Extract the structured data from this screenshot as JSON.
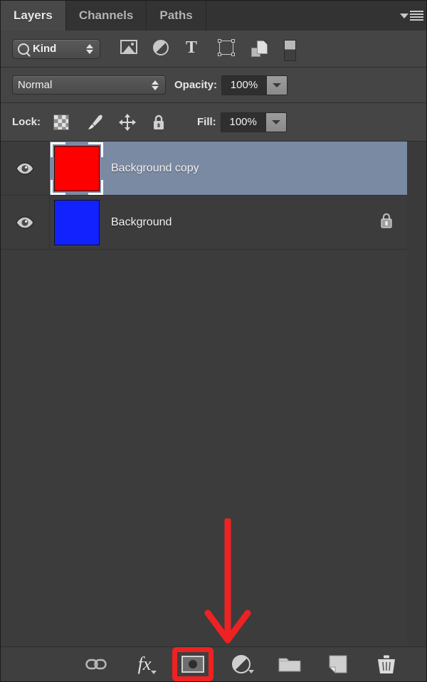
{
  "panel": {
    "title": "Layers Panel",
    "tabs": [
      {
        "label": "Layers",
        "active": true
      },
      {
        "label": "Channels",
        "active": false
      },
      {
        "label": "Paths",
        "active": false
      }
    ],
    "menu_icon": "panel-menu-icon"
  },
  "filter_bar": {
    "kind_label": "Kind",
    "search_icon": "magnifier-icon",
    "filter_icons": [
      "pixel-layer-filter-icon",
      "adjustment-layer-filter-icon",
      "type-layer-filter-icon",
      "shape-layer-filter-icon",
      "smart-object-filter-icon",
      "filter-toggle-switch-icon"
    ]
  },
  "blend_bar": {
    "blend_mode": "Normal",
    "opacity_label": "Opacity:",
    "opacity_value": "100%"
  },
  "lock_bar": {
    "lock_label": "Lock:",
    "lock_icons": [
      "lock-transparent-pixels-icon",
      "lock-image-pixels-icon",
      "lock-position-icon",
      "lock-all-icon"
    ],
    "fill_label": "Fill:",
    "fill_value": "100%"
  },
  "layers": [
    {
      "name": "Background copy",
      "visible": true,
      "selected": true,
      "thumbnail_color": "#ff0000",
      "locked": false
    },
    {
      "name": "Background",
      "visible": true,
      "selected": false,
      "thumbnail_color": "#1122ff",
      "locked": true
    }
  ],
  "annotation": {
    "type": "arrow",
    "direction": "down",
    "color": "#ee2222",
    "points_to": "add-layer-mask-button"
  },
  "bottom_bar": {
    "highlight_color": "#ef2222",
    "buttons": [
      {
        "name": "link-layers-button",
        "icon": "link-icon",
        "highlighted": false
      },
      {
        "name": "layer-style-button",
        "icon": "fx-icon",
        "highlighted": false
      },
      {
        "name": "add-layer-mask-button",
        "icon": "mask-icon",
        "highlighted": true
      },
      {
        "name": "new-adjustment-layer-button",
        "icon": "adjustment-circle-icon",
        "highlighted": false
      },
      {
        "name": "new-group-button",
        "icon": "folder-icon",
        "highlighted": false
      },
      {
        "name": "new-layer-button",
        "icon": "new-layer-icon",
        "highlighted": false
      },
      {
        "name": "delete-layer-button",
        "icon": "trash-icon",
        "highlighted": false
      }
    ]
  }
}
